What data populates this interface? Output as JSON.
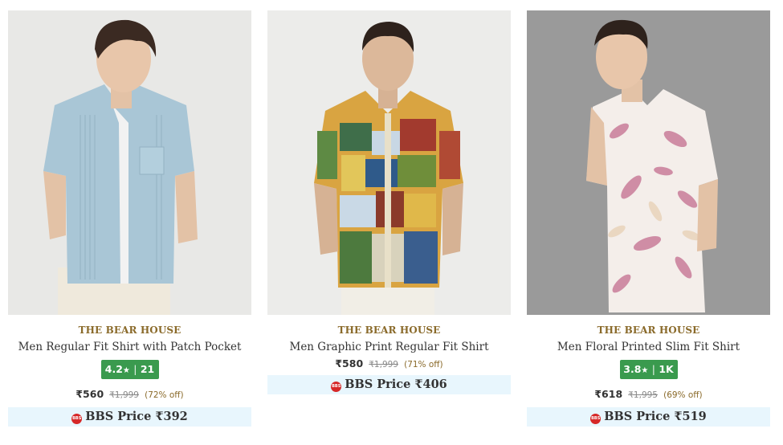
{
  "products": [
    {
      "brand": "THE BEAR HOUSE",
      "title": "Men Regular Fit Shirt with Patch Pocket",
      "rating": "4.2",
      "rating_count": "21",
      "price": "₹560",
      "mrp": "₹1,999",
      "discount": "(72% off)",
      "bbs_label": "BBS Price ₹392",
      "colors": {
        "shirt": "#a9c6d6",
        "background": "#e8e8e6"
      }
    },
    {
      "brand": "THE BEAR HOUSE",
      "title": "Men Graphic Print Regular Fit Shirt",
      "price": "₹580",
      "mrp": "₹1,999",
      "discount": "(71% off)",
      "bbs_label": "BBS Price ₹406",
      "colors": {
        "shirt": "multicolor",
        "background": "#ececea"
      }
    },
    {
      "brand": "THE BEAR HOUSE",
      "title": "Men Floral Printed Slim Fit Shirt",
      "rating": "3.8",
      "rating_count": "1K",
      "price": "₹618",
      "mrp": "₹1,995",
      "discount": "(69% off)",
      "bbs_label": "BBS Price ₹519",
      "colors": {
        "shirt": "#f4eeea",
        "background": "#9a9a9a"
      }
    }
  ],
  "rating_star": "★",
  "rating_separator": "|",
  "bbs_logo_text": "BBS",
  "colors": {
    "rating_green": "#3a9a4e",
    "brand_gold": "#8a6a2a",
    "bbs_bg": "#e8f6fd"
  }
}
